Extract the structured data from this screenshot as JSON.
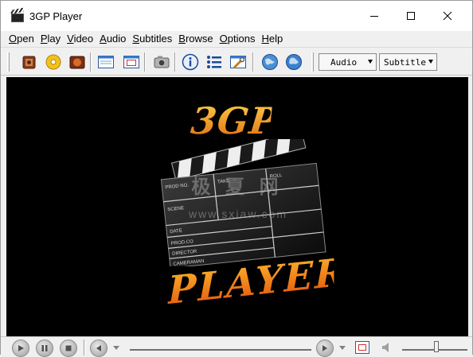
{
  "window": {
    "title": "3GP Player",
    "controls": {
      "minimize": "minimize",
      "maximize": "maximize",
      "close": "close"
    }
  },
  "menubar": {
    "items": [
      {
        "label": "Open"
      },
      {
        "label": "Play"
      },
      {
        "label": "Video"
      },
      {
        "label": "Audio"
      },
      {
        "label": "Subtitles"
      },
      {
        "label": "Browse"
      },
      {
        "label": "Options"
      },
      {
        "label": "Help"
      }
    ]
  },
  "toolbar": {
    "icons": [
      "open-file-icon",
      "open-disc-icon",
      "open-url-icon",
      "fullscreen-window-icon",
      "fit-window-icon",
      "screenshot-camera-icon",
      "info-icon",
      "playlist-icon",
      "settings-tools-icon",
      "web-globe-icon",
      "update-globe-icon"
    ],
    "audio_dropdown": "Audio",
    "subtitle_dropdown": "Subtitle"
  },
  "video": {
    "logo_top": "3GP",
    "logo_bottom": "PLAYER",
    "clapper_fields": [
      "PROD NO.",
      "TAKE",
      "ROLL",
      "SCENE",
      "DATE",
      "PROD.CO",
      "DIRECTOR",
      "CAMERAMAN"
    ],
    "watermark": "极 夏 网",
    "watermark_url": "www.sxiaw.com"
  },
  "controls": {
    "icons": [
      "play-icon",
      "pause-icon",
      "stop-icon",
      "previous-icon",
      "next-icon",
      "fullscreen-icon",
      "volume-icon"
    ],
    "seek_position": 0.0,
    "volume_level": 0.5
  },
  "colors": {
    "titlebar": "#ffffff",
    "chrome": "#f0f0f0",
    "video_bg": "#000000",
    "logo_gradient_top": "#ffd24a",
    "logo_gradient_bottom": "#e06a10"
  }
}
